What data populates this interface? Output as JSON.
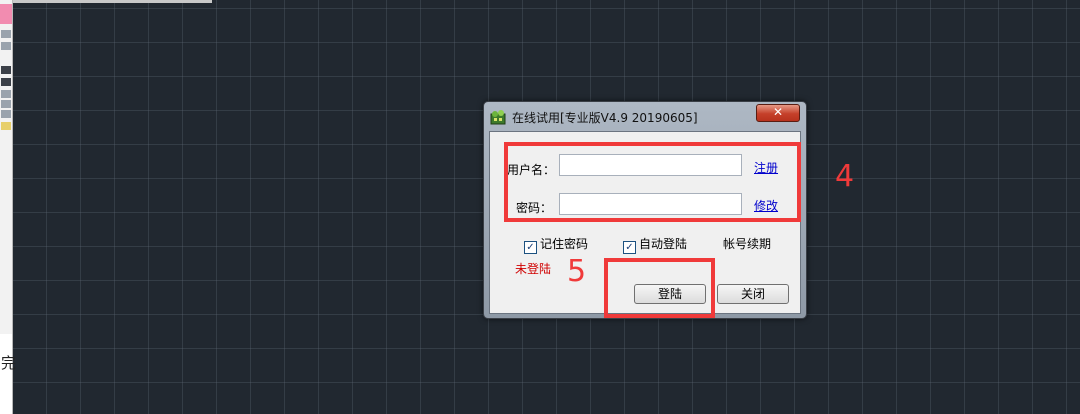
{
  "host": {
    "side_text": "完"
  },
  "dialog": {
    "title": "在线试用[专业版V4.9 20190605]",
    "close_glyph": "✕",
    "username_label": "用户名：",
    "username_value": "",
    "password_label": "密码：",
    "password_value": "",
    "register_link": "注册",
    "modify_link": "修改",
    "remember_password": {
      "label": "记住密码",
      "checked": true
    },
    "auto_login": {
      "label": "自动登陆",
      "checked": true
    },
    "renew_label": "帐号续期",
    "status_text": "未登陆",
    "login_button": "登陆",
    "close_button": "关闭"
  },
  "annotations": {
    "step_credentials": "4",
    "step_login": "5",
    "color": "#f03a3a"
  },
  "colors": {
    "canvas_background": "#212830",
    "status_red": "#d00000",
    "link_blue": "#0000cc"
  }
}
